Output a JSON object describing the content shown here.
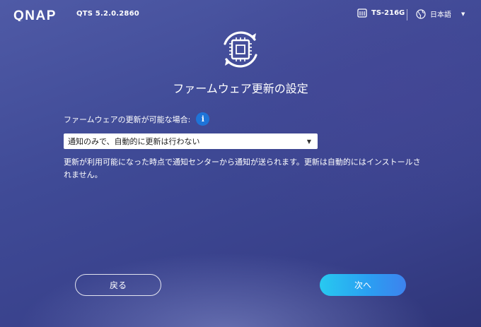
{
  "header": {
    "brand": "QNAP",
    "version": "QTS 5.2.0.2860",
    "device_name": "TS-216G",
    "language": "日本語"
  },
  "icons": {
    "logo": "qnap-logo",
    "device": "nas-device-icon",
    "language": "globe-icon",
    "hero": "firmware-update-icon",
    "info": "info-icon"
  },
  "page": {
    "title": "ファームウェア更新の設定"
  },
  "form": {
    "label": "ファームウェアの更新が可能な場合:",
    "info_glyph": "i",
    "select_value": "通知のみで、自動的に更新は行わない",
    "description": "更新が利用可能になった時点で通知センターから通知が送られます。更新は自動的にはインストールされません。"
  },
  "buttons": {
    "back": "戻る",
    "next": "次へ"
  },
  "colors": {
    "background": "#3f4a96",
    "info_badge": "#1e74d8",
    "next_button": "#2aa0f2"
  }
}
